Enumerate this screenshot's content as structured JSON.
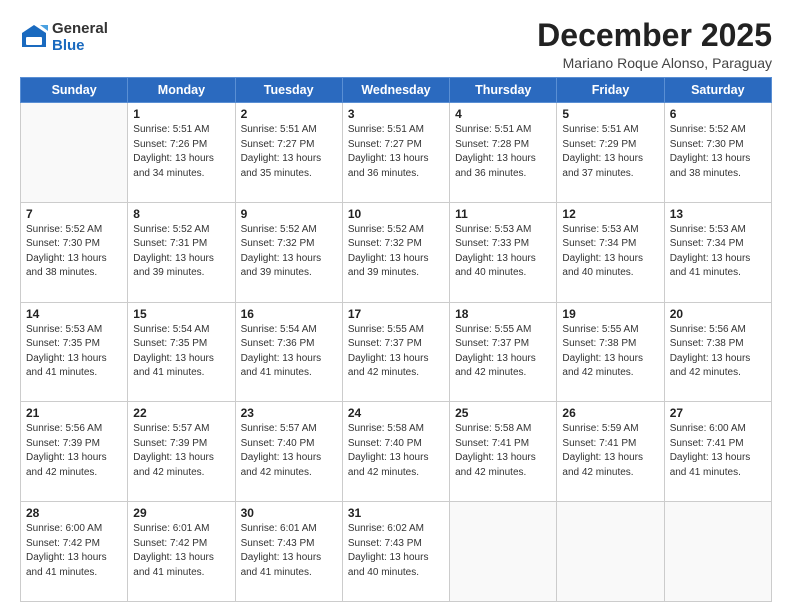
{
  "header": {
    "logo_general": "General",
    "logo_blue": "Blue",
    "month_title": "December 2025",
    "location": "Mariano Roque Alonso, Paraguay"
  },
  "days_of_week": [
    "Sunday",
    "Monday",
    "Tuesday",
    "Wednesday",
    "Thursday",
    "Friday",
    "Saturday"
  ],
  "weeks": [
    [
      {
        "day": "",
        "text": ""
      },
      {
        "day": "1",
        "text": "Sunrise: 5:51 AM\nSunset: 7:26 PM\nDaylight: 13 hours\nand 34 minutes."
      },
      {
        "day": "2",
        "text": "Sunrise: 5:51 AM\nSunset: 7:27 PM\nDaylight: 13 hours\nand 35 minutes."
      },
      {
        "day": "3",
        "text": "Sunrise: 5:51 AM\nSunset: 7:27 PM\nDaylight: 13 hours\nand 36 minutes."
      },
      {
        "day": "4",
        "text": "Sunrise: 5:51 AM\nSunset: 7:28 PM\nDaylight: 13 hours\nand 36 minutes."
      },
      {
        "day": "5",
        "text": "Sunrise: 5:51 AM\nSunset: 7:29 PM\nDaylight: 13 hours\nand 37 minutes."
      },
      {
        "day": "6",
        "text": "Sunrise: 5:52 AM\nSunset: 7:30 PM\nDaylight: 13 hours\nand 38 minutes."
      }
    ],
    [
      {
        "day": "7",
        "text": "Sunrise: 5:52 AM\nSunset: 7:30 PM\nDaylight: 13 hours\nand 38 minutes."
      },
      {
        "day": "8",
        "text": "Sunrise: 5:52 AM\nSunset: 7:31 PM\nDaylight: 13 hours\nand 39 minutes."
      },
      {
        "day": "9",
        "text": "Sunrise: 5:52 AM\nSunset: 7:32 PM\nDaylight: 13 hours\nand 39 minutes."
      },
      {
        "day": "10",
        "text": "Sunrise: 5:52 AM\nSunset: 7:32 PM\nDaylight: 13 hours\nand 39 minutes."
      },
      {
        "day": "11",
        "text": "Sunrise: 5:53 AM\nSunset: 7:33 PM\nDaylight: 13 hours\nand 40 minutes."
      },
      {
        "day": "12",
        "text": "Sunrise: 5:53 AM\nSunset: 7:34 PM\nDaylight: 13 hours\nand 40 minutes."
      },
      {
        "day": "13",
        "text": "Sunrise: 5:53 AM\nSunset: 7:34 PM\nDaylight: 13 hours\nand 41 minutes."
      }
    ],
    [
      {
        "day": "14",
        "text": "Sunrise: 5:53 AM\nSunset: 7:35 PM\nDaylight: 13 hours\nand 41 minutes."
      },
      {
        "day": "15",
        "text": "Sunrise: 5:54 AM\nSunset: 7:35 PM\nDaylight: 13 hours\nand 41 minutes."
      },
      {
        "day": "16",
        "text": "Sunrise: 5:54 AM\nSunset: 7:36 PM\nDaylight: 13 hours\nand 41 minutes."
      },
      {
        "day": "17",
        "text": "Sunrise: 5:55 AM\nSunset: 7:37 PM\nDaylight: 13 hours\nand 42 minutes."
      },
      {
        "day": "18",
        "text": "Sunrise: 5:55 AM\nSunset: 7:37 PM\nDaylight: 13 hours\nand 42 minutes."
      },
      {
        "day": "19",
        "text": "Sunrise: 5:55 AM\nSunset: 7:38 PM\nDaylight: 13 hours\nand 42 minutes."
      },
      {
        "day": "20",
        "text": "Sunrise: 5:56 AM\nSunset: 7:38 PM\nDaylight: 13 hours\nand 42 minutes."
      }
    ],
    [
      {
        "day": "21",
        "text": "Sunrise: 5:56 AM\nSunset: 7:39 PM\nDaylight: 13 hours\nand 42 minutes."
      },
      {
        "day": "22",
        "text": "Sunrise: 5:57 AM\nSunset: 7:39 PM\nDaylight: 13 hours\nand 42 minutes."
      },
      {
        "day": "23",
        "text": "Sunrise: 5:57 AM\nSunset: 7:40 PM\nDaylight: 13 hours\nand 42 minutes."
      },
      {
        "day": "24",
        "text": "Sunrise: 5:58 AM\nSunset: 7:40 PM\nDaylight: 13 hours\nand 42 minutes."
      },
      {
        "day": "25",
        "text": "Sunrise: 5:58 AM\nSunset: 7:41 PM\nDaylight: 13 hours\nand 42 minutes."
      },
      {
        "day": "26",
        "text": "Sunrise: 5:59 AM\nSunset: 7:41 PM\nDaylight: 13 hours\nand 42 minutes."
      },
      {
        "day": "27",
        "text": "Sunrise: 6:00 AM\nSunset: 7:41 PM\nDaylight: 13 hours\nand 41 minutes."
      }
    ],
    [
      {
        "day": "28",
        "text": "Sunrise: 6:00 AM\nSunset: 7:42 PM\nDaylight: 13 hours\nand 41 minutes."
      },
      {
        "day": "29",
        "text": "Sunrise: 6:01 AM\nSunset: 7:42 PM\nDaylight: 13 hours\nand 41 minutes."
      },
      {
        "day": "30",
        "text": "Sunrise: 6:01 AM\nSunset: 7:43 PM\nDaylight: 13 hours\nand 41 minutes."
      },
      {
        "day": "31",
        "text": "Sunrise: 6:02 AM\nSunset: 7:43 PM\nDaylight: 13 hours\nand 40 minutes."
      },
      {
        "day": "",
        "text": ""
      },
      {
        "day": "",
        "text": ""
      },
      {
        "day": "",
        "text": ""
      }
    ]
  ]
}
